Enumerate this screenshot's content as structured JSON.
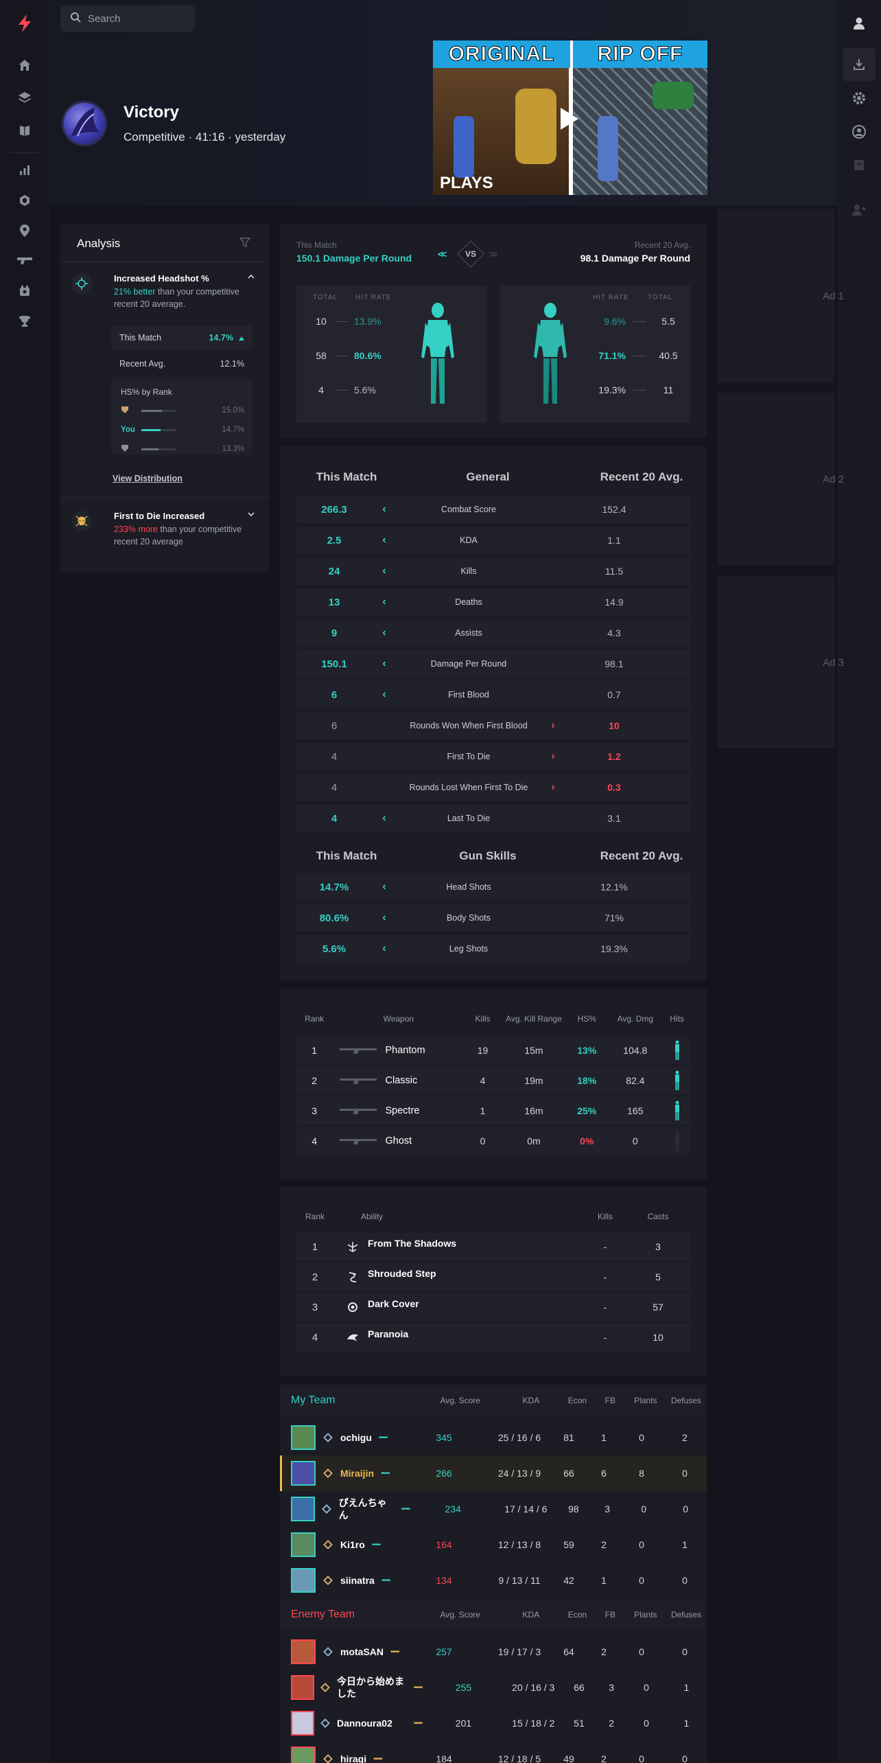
{
  "search": {
    "placeholder": "Search"
  },
  "match": {
    "result": "Victory",
    "meta": "Competitive  ·  41:16  ·  yesterday"
  },
  "video": {
    "left_label": "ORIGINAL",
    "right_label": "RIP OFF",
    "corner_label": "PLAYS"
  },
  "analysis": {
    "title": "Analysis",
    "insight1": {
      "title": "Increased Headshot %",
      "highlight": "21% better",
      "rest": " than your competitive recent 20 average."
    },
    "this_match": {
      "label": "This Match",
      "value": "14.7%"
    },
    "recent_avg": {
      "label": "Recent Avg.",
      "value": "12.1%"
    },
    "by_rank": {
      "title": "HS% by Rank",
      "rows": [
        {
          "label": "",
          "value": "15.0%",
          "fill": 0.6
        },
        {
          "label": "You",
          "value": "14.7%",
          "fill": 0.55
        },
        {
          "label": "",
          "value": "13.3%",
          "fill": 0.5
        }
      ]
    },
    "view_distribution": "View Distribution",
    "insight2": {
      "title": "First to Die Increased",
      "highlight": " 233% more",
      "rest": " than your competitive recent 20 average"
    }
  },
  "damage": {
    "left_label": "This Match",
    "left_value": "150.1 Damage Per Round",
    "vs": "VS",
    "right_label": "Recent 20 Avg.",
    "right_value": "98.1 Damage Per Round",
    "col_total": "TOTAL",
    "col_hit": "HIT RATE",
    "left_rows": [
      {
        "total": "10",
        "rate": "13.9%"
      },
      {
        "total": "58",
        "rate": "80.6%"
      },
      {
        "total": "4",
        "rate": "5.6%"
      }
    ],
    "right_rows": [
      {
        "total": "5.5",
        "rate": "9.6%"
      },
      {
        "total": "40.5",
        "rate": "71.1%"
      },
      {
        "total": "11",
        "rate": "19.3%"
      }
    ]
  },
  "general": {
    "head_left": "This Match",
    "head_mid": "General",
    "head_right": "Recent 20 Avg.",
    "rows": [
      {
        "a": "266.3",
        "label": "Combat Score",
        "b": "152.4",
        "better": "left"
      },
      {
        "a": "2.5",
        "label": "KDA",
        "b": "1.1",
        "better": "left"
      },
      {
        "a": "24",
        "label": "Kills",
        "b": "11.5",
        "better": "left"
      },
      {
        "a": "13",
        "label": "Deaths",
        "b": "14.9",
        "better": "left"
      },
      {
        "a": "9",
        "label": "Assists",
        "b": "4.3",
        "better": "left"
      },
      {
        "a": "150.1",
        "label": "Damage Per Round",
        "b": "98.1",
        "better": "left"
      },
      {
        "a": "6",
        "label": "First Blood",
        "b": "0.7",
        "better": "left"
      },
      {
        "a": "6",
        "label": "Rounds Won When First Blood",
        "b": "10",
        "better": "right"
      },
      {
        "a": "4",
        "label": "First To Die",
        "b": "1.2",
        "better": "right"
      },
      {
        "a": "4",
        "label": "Rounds Lost When First To Die",
        "b": "0.3",
        "better": "right"
      },
      {
        "a": "4",
        "label": "Last To Die",
        "b": "3.1",
        "better": "left"
      }
    ],
    "gun_head_left": "This Match",
    "gun_head_mid": "Gun Skills",
    "gun_head_right": "Recent 20 Avg.",
    "gun_rows": [
      {
        "a": "14.7%",
        "label": "Head Shots",
        "b": "12.1%",
        "better": "left"
      },
      {
        "a": "80.6%",
        "label": "Body Shots",
        "b": "71%",
        "better": "left"
      },
      {
        "a": "5.6%",
        "label": "Leg Shots",
        "b": "19.3%",
        "better": "left"
      }
    ]
  },
  "weapons": {
    "headers": [
      "Rank",
      "Weapon",
      "Kills",
      "Avg. Kill Range",
      "HS%",
      "Avg. Dmg",
      "Hits"
    ],
    "rows": [
      {
        "rank": "1",
        "name": "Phantom",
        "kills": "19",
        "range": "15m",
        "hs": "13%",
        "dmg": "104.8"
      },
      {
        "rank": "2",
        "name": "Classic",
        "kills": "4",
        "range": "19m",
        "hs": "18%",
        "dmg": "82.4"
      },
      {
        "rank": "3",
        "name": "Spectre",
        "kills": "1",
        "range": "16m",
        "hs": "25%",
        "dmg": "165"
      },
      {
        "rank": "4",
        "name": "Ghost",
        "kills": "0",
        "range": "0m",
        "hs": "0%",
        "dmg": "0"
      }
    ]
  },
  "abilities": {
    "headers": [
      "Rank",
      "Ability",
      "Kills",
      "Casts"
    ],
    "rows": [
      {
        "rank": "1",
        "name": "From The Shadows",
        "kills": "-",
        "casts": "3"
      },
      {
        "rank": "2",
        "name": "Shrouded Step",
        "kills": "-",
        "casts": "5"
      },
      {
        "rank": "3",
        "name": "Dark Cover",
        "kills": "-",
        "casts": "57"
      },
      {
        "rank": "4",
        "name": "Paranoia",
        "kills": "-",
        "casts": "10"
      }
    ]
  },
  "teams": {
    "headers": [
      "Avg. Score",
      "KDA",
      "Econ",
      "FB",
      "Plants",
      "Defuses"
    ],
    "my_team": {
      "title": "My Team",
      "players": [
        {
          "name": "ochigu",
          "score": "345",
          "kda": "25 / 16 / 6",
          "econ": "81",
          "fb": "1",
          "plants": "0",
          "defuses": "2",
          "score_color": "teal"
        },
        {
          "name": "Miraijin",
          "score": "266",
          "kda": "24 / 13 / 9",
          "econ": "66",
          "fb": "6",
          "plants": "8",
          "defuses": "0",
          "score_color": "teal",
          "self": true
        },
        {
          "name": "ぴえんちゃん",
          "score": "234",
          "kda": "17 / 14 / 6",
          "econ": "98",
          "fb": "3",
          "plants": "0",
          "defuses": "0",
          "score_color": "teal"
        },
        {
          "name": "Ki1ro",
          "score": "164",
          "kda": "12 / 13 / 8",
          "econ": "59",
          "fb": "2",
          "plants": "0",
          "defuses": "1",
          "score_color": "red"
        },
        {
          "name": "siinatra",
          "score": "134",
          "kda": "9 / 13 / 11",
          "econ": "42",
          "fb": "1",
          "plants": "0",
          "defuses": "0",
          "score_color": "red"
        }
      ]
    },
    "enemy_team": {
      "title": "Enemy Team",
      "players": [
        {
          "name": "motaSAN",
          "score": "257",
          "kda": "19 / 17 / 3",
          "econ": "64",
          "fb": "2",
          "plants": "0",
          "defuses": "0",
          "score_color": "teal"
        },
        {
          "name": "今日から始めました",
          "score": "255",
          "kda": "20 / 16 / 3",
          "econ": "66",
          "fb": "3",
          "plants": "0",
          "defuses": "1",
          "score_color": "teal"
        },
        {
          "name": "Dannoura02",
          "score": "201",
          "kda": "15 / 18 / 2",
          "econ": "51",
          "fb": "2",
          "plants": "0",
          "defuses": "1",
          "score_color": "white"
        },
        {
          "name": "hiragi",
          "score": "184",
          "kda": "12 / 18 / 5",
          "econ": "49",
          "fb": "2",
          "plants": "0",
          "defuses": "0",
          "score_color": "white"
        }
      ]
    }
  },
  "ads": [
    "Ad 1",
    "Ad 2",
    "Ad 3"
  ],
  "colors": {
    "accent": "#35d0c4",
    "negative": "#ff4655",
    "self_highlight": "#e9b856",
    "brand": "#ff4655"
  }
}
